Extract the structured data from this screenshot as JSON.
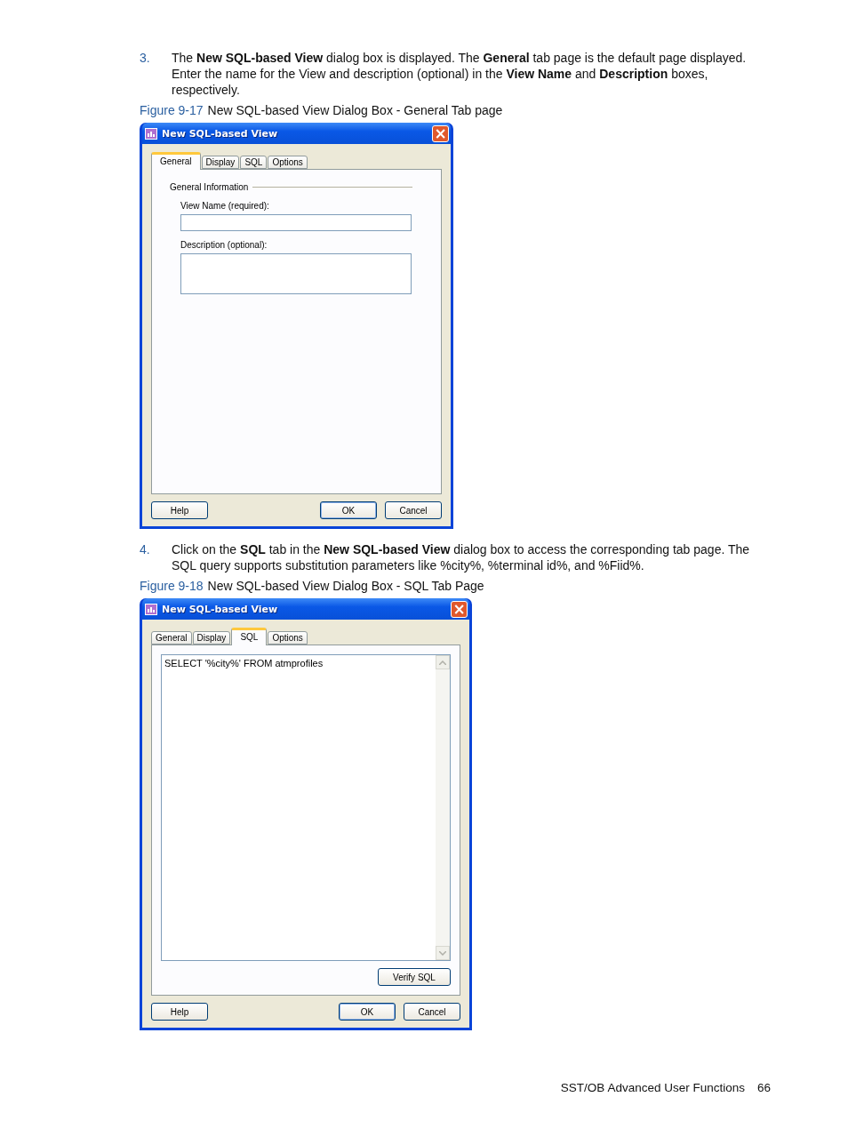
{
  "sections": [
    {
      "step": {
        "number": "3.",
        "text": "The **New SQL-based View** dialog box is displayed.  The **General** tab page is the default page displayed. Enter the name for the View and description (optional) in the **View Name** and **Description** boxes, respectively."
      },
      "figure": {
        "label": "Figure 9-17",
        "caption": "New SQL-based View Dialog Box - General Tab page",
        "dialog": {
          "title": "New SQL-based View",
          "close": "×",
          "tabs": [
            {
              "label": "General",
              "selected": true
            },
            {
              "label": "Display",
              "selected": false
            },
            {
              "label": "SQL",
              "selected": false
            },
            {
              "label": "Options",
              "selected": false
            }
          ],
          "panel": {
            "kind": "general",
            "group": "General Information",
            "fields": [
              {
                "kind": "line",
                "label": "View Name (required):"
              },
              {
                "kind": "multiline",
                "label": "Description (optional):"
              }
            ]
          },
          "buttons": {
            "left": [
              "Help"
            ],
            "right": [
              {
                "label": "OK",
                "default": true
              },
              {
                "label": "Cancel",
                "default": false
              }
            ]
          }
        }
      }
    },
    {
      "step": {
        "number": "4.",
        "text": "Click on the **SQL** tab in the **New SQL-based View** dialog box to access the corresponding tab page.  The SQL query supports substitution parameters like %city%, %terminal id%, and %Fiid%."
      },
      "figure": {
        "label": "Figure 9-18",
        "caption": "New SQL-based View Dialog Box - SQL Tab Page",
        "dialog": {
          "title": "New SQL-based View",
          "close": "×",
          "tabs": [
            {
              "label": "General",
              "selected": false
            },
            {
              "label": "Display",
              "selected": false
            },
            {
              "label": "SQL",
              "selected": true
            },
            {
              "label": "Options",
              "selected": false
            }
          ],
          "panel": {
            "kind": "sql",
            "query": "SELECT '%city%'  FROM atmprofiles",
            "action": "Verify SQL"
          },
          "buttons": {
            "left": [
              "Help"
            ],
            "right": [
              {
                "label": "OK",
                "default": true
              },
              {
                "label": "Cancel",
                "default": false
              }
            ]
          }
        }
      }
    }
  ],
  "footer": {
    "title": "SST/OB Advanced User Functions",
    "page": "66"
  }
}
